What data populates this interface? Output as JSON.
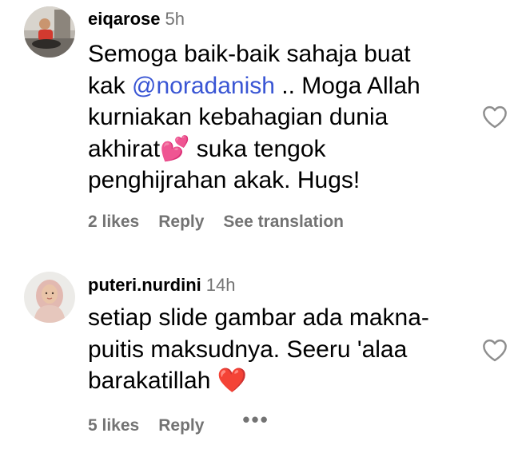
{
  "comments": [
    {
      "username": "eiqarose",
      "time": "5h",
      "avatar_icon": "user-photo-avatar",
      "text_lines": [
        "Semoga baik-baik sahaja buat",
        "kak",
        "@noradanish",
        ".. Moga Allah",
        "kurniakan kebahagian dunia",
        "akhirat",
        "💕",
        " suka tengok",
        "penghijrahan akak. Hugs!"
      ],
      "likes": "2 likes",
      "reply": "Reply",
      "translate": "See translation",
      "like_icon": "heart-outline-icon"
    },
    {
      "username": "puteri.nurdini",
      "time": "14h",
      "avatar_icon": "user-photo-avatar",
      "text_lines": [
        "setiap slide gambar ada makna-",
        "puitis maksudnya. Seeru 'alaa",
        "barakatillah",
        "❤️"
      ],
      "likes": "5 likes",
      "reply": "Reply",
      "more": "•••",
      "like_icon": "heart-outline-icon"
    }
  ],
  "colors": {
    "text": "#000000",
    "secondary": "#737373",
    "mention": "#3a56d4",
    "heart_emoji": "#e0245e"
  }
}
